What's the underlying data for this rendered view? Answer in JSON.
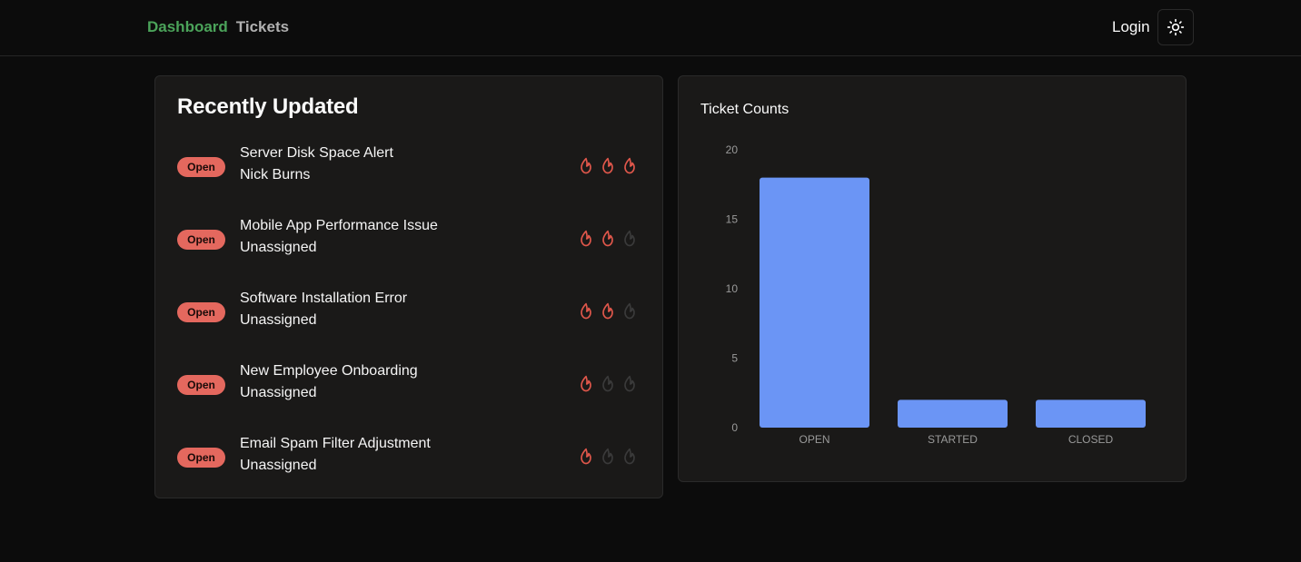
{
  "nav": {
    "dashboard": "Dashboard",
    "tickets": "Tickets",
    "login": "Login",
    "theme_icon": "sun-icon"
  },
  "recent": {
    "title": "Recently Updated",
    "tickets": [
      {
        "status": "Open",
        "title": "Server Disk Space Alert",
        "assignee": "Nick Burns",
        "priority": 3
      },
      {
        "status": "Open",
        "title": "Mobile App Performance Issue",
        "assignee": "Unassigned",
        "priority": 2
      },
      {
        "status": "Open",
        "title": "Software Installation Error",
        "assignee": "Unassigned",
        "priority": 2
      },
      {
        "status": "Open",
        "title": "New Employee Onboarding",
        "assignee": "Unassigned",
        "priority": 1
      },
      {
        "status": "Open",
        "title": "Email Spam Filter Adjustment",
        "assignee": "Unassigned",
        "priority": 1
      }
    ],
    "priority_max": 3
  },
  "colors": {
    "active_nav": "#4ba35a",
    "badge": "#e4685e",
    "flame_on": "#e0574b",
    "flame_off": "#3a3a3a",
    "bar": "#6b95f5"
  },
  "chart_data": {
    "type": "bar",
    "title": "Ticket Counts",
    "categories": [
      "OPEN",
      "STARTED",
      "CLOSED"
    ],
    "values": [
      18,
      2,
      2
    ],
    "yticks": [
      0,
      5,
      10,
      15,
      20
    ],
    "ylim": [
      0,
      20
    ],
    "grid": false,
    "xlabel": "",
    "ylabel": ""
  }
}
